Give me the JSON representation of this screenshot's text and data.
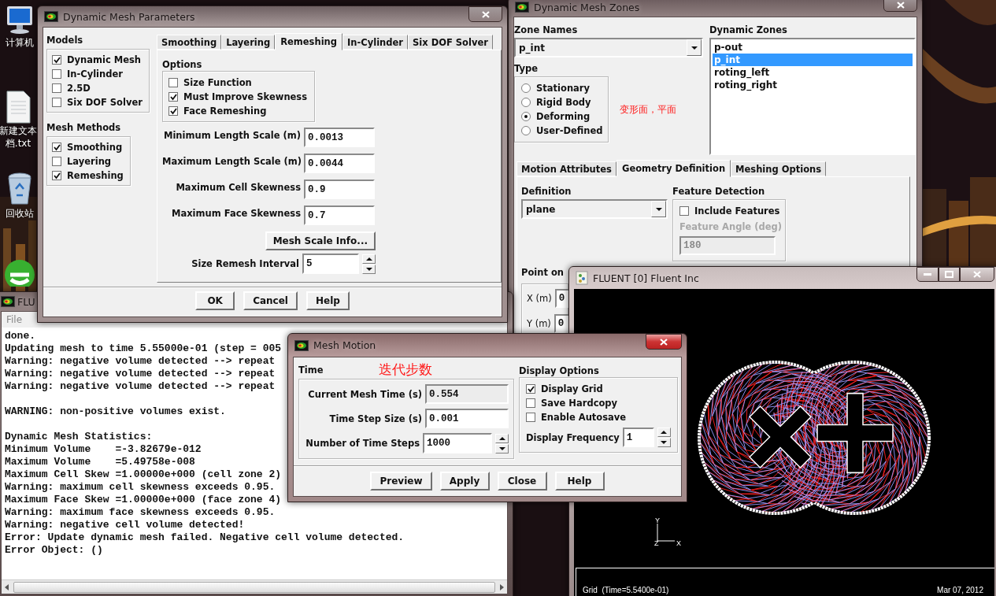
{
  "desktop": {
    "icons": [
      {
        "kind": "computer",
        "lines": [
          "计算机"
        ]
      },
      {
        "kind": "document",
        "lines": [
          "新建文本",
          "档.txt"
        ]
      },
      {
        "kind": "recycle",
        "lines": [
          "回收站"
        ]
      },
      {
        "kind": "app"
      }
    ]
  },
  "zones_window": {
    "title": "Dynamic Mesh Zones",
    "zone_names": {
      "label": "Zone Names",
      "value": "p_int"
    },
    "type": {
      "label": "Type",
      "options": [
        {
          "label": "Stationary",
          "selected": false
        },
        {
          "label": "Rigid Body",
          "selected": false
        },
        {
          "label": "Deforming",
          "selected": true
        },
        {
          "label": "User-Defined",
          "selected": false
        }
      ]
    },
    "note": "变形面，平面",
    "dynamic_zones": {
      "label": "Dynamic Zones",
      "items": [
        {
          "label": "p-out",
          "selected": false
        },
        {
          "label": "p_int",
          "selected": true
        },
        {
          "label": "roting_left",
          "selected": false
        },
        {
          "label": "roting_right",
          "selected": false
        }
      ]
    },
    "tabs": [
      {
        "label": "Motion Attributes",
        "selected": false
      },
      {
        "label": "Geometry Definition",
        "selected": true
      },
      {
        "label": "Meshing Options",
        "selected": false
      }
    ],
    "definition": {
      "label": "Definition",
      "value": "plane"
    },
    "feature_detection": {
      "label": "Feature Detection",
      "include": {
        "label": "Include Features",
        "checked": false
      },
      "angle": {
        "label": "Feature Angle (deg)",
        "value": "180",
        "disabled": true
      }
    },
    "point": {
      "label": "Point on",
      "fields": [
        {
          "label": "X (m)",
          "value": "0"
        },
        {
          "label": "Y (m)",
          "value": "0"
        }
      ]
    }
  },
  "console": {
    "title": "FLU",
    "menu": [
      "File"
    ],
    "blocks": [
      [
        "done.",
        "Updating mesh to time 5.55000e-01 (step = 005",
        "Warning: negative volume detected --> repeat",
        "Warning: negative volume detected --> repeat",
        "Warning: negative volume detected --> repeat"
      ],
      [
        "WARNING: non-positive volumes exist."
      ],
      [
        "Dynamic Mesh Statistics:",
        "Minimum Volume    =-3.82679e-012",
        "Maximum Volume    =5.49758e-008",
        "Maximum Cell Skew =1.00000e+000 (cell zone 2)",
        "Warning: maximum cell skewness exceeds 0.95.",
        "Maximum Face Skew =1.00000e+000 (face zone 4)",
        "Warning: maximum face skewness exceeds 0.95.",
        "Warning: negative cell volume detected!",
        "Error: Update dynamic mesh failed. Negative cell volume detected.",
        "Error Object: ()"
      ]
    ]
  },
  "parameters_window": {
    "title": "Dynamic Mesh Parameters",
    "groups": [
      {
        "label": "Models",
        "items": [
          {
            "label": "Dynamic Mesh",
            "checked": true
          },
          {
            "label": "In-Cylinder",
            "checked": false
          },
          {
            "label": "2.5D",
            "checked": false
          },
          {
            "label": "Six DOF Solver",
            "checked": false
          }
        ]
      },
      {
        "label": "Mesh Methods",
        "items": [
          {
            "label": "Smoothing",
            "checked": true
          },
          {
            "label": "Layering",
            "checked": false
          },
          {
            "label": "Remeshing",
            "checked": true
          }
        ]
      }
    ],
    "tabs": [
      {
        "label": "Smoothing",
        "selected": false
      },
      {
        "label": "Layering",
        "selected": false
      },
      {
        "label": "Remeshing",
        "selected": true
      },
      {
        "label": "In-Cylinder",
        "selected": false
      },
      {
        "label": "Six DOF Solver",
        "selected": false
      }
    ],
    "options": {
      "label": "Options",
      "items": [
        {
          "label": "Size Function",
          "checked": false
        },
        {
          "label": "Must Improve Skewness",
          "checked": true
        },
        {
          "label": "Face Remeshing",
          "checked": true
        }
      ]
    },
    "fields": [
      {
        "label": "Minimum Length Scale (m)",
        "value": "0.0013"
      },
      {
        "label": "Maximum Length Scale (m)",
        "value": "0.0044"
      },
      {
        "label": "Maximum Cell Skewness",
        "value": "0.9"
      },
      {
        "label": "Maximum Face Skewness",
        "value": "0.7"
      }
    ],
    "scale_info_button": "Mesh Scale Info...",
    "interval": {
      "label": "Size Remesh Interval",
      "value": "5"
    },
    "buttons": [
      "OK",
      "Cancel",
      "Help"
    ]
  },
  "graphics_window": {
    "title": "FLUENT [0] Fluent Inc",
    "axes": [
      "Y",
      "Z",
      "X"
    ],
    "status_left": "Grid  (Time=5.5400e-01)",
    "status_right": "Mar 07, 2012"
  },
  "mesh_motion": {
    "title": "Mesh Motion",
    "note": "迭代步数",
    "time": {
      "label": "Time",
      "fields": [
        {
          "label": "Current Mesh Time (s)",
          "value": "0.554",
          "kind": "readonly"
        },
        {
          "label": "Time Step Size (s)",
          "value": "0.001",
          "kind": "text"
        },
        {
          "label": "Number of Time Steps",
          "value": "1000",
          "kind": "spin"
        }
      ]
    },
    "display": {
      "label": "Display Options",
      "items": [
        {
          "label": "Display Grid",
          "checked": true
        },
        {
          "label": "Save Hardcopy",
          "checked": false
        },
        {
          "label": "Enable Autosave",
          "checked": false
        }
      ],
      "frequency": {
        "label": "Display Frequency",
        "value": "1"
      }
    },
    "buttons": [
      "Preview",
      "Apply",
      "Close",
      "Help"
    ]
  }
}
